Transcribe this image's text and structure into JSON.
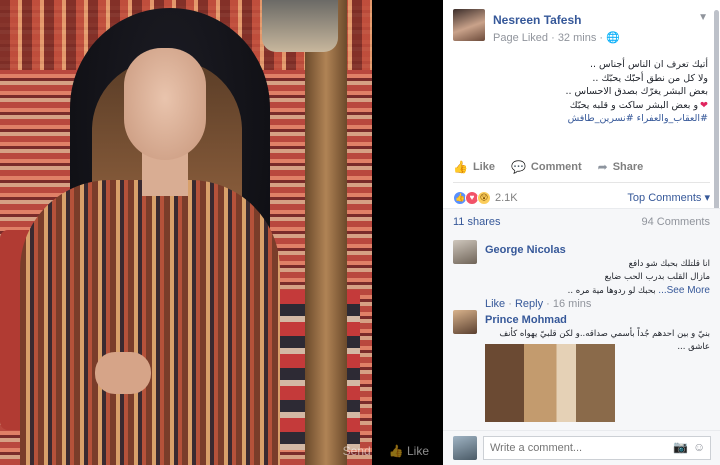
{
  "photo": {
    "footer_items": [
      "Send",
      "Like"
    ]
  },
  "post": {
    "page_name": "Nesreen Tafesh",
    "meta": "Page Liked · 32 mins ·",
    "text_lines": [
      "أتيك تعرف ان الناس أجناس ..",
      "ولا كل من نطق أحبّك يحبّك ..",
      "بعض البشر يغرّك بصدق الاحساس ..",
      "و بعض البشر ساكت و قلبه يحبّك"
    ],
    "hashtags": "#العقاب_والعفراء #نسرين_طافش",
    "actions": {
      "like": "Like",
      "comment": "Comment",
      "share": "Share"
    },
    "reaction_count": "2.1K",
    "top_comments": "Top Comments",
    "shares": "11 shares",
    "comment_count": "94 Comments"
  },
  "comments": [
    {
      "author": "George Nicolas",
      "lines": [
        "انا قلتلك بحبك شو دافع",
        "مازال القلب بدرب الحب ضايع",
        "بحبك لو ردوها مية مره .."
      ],
      "see_more": "See More...",
      "like": "Like",
      "reply": "Reply",
      "time": "16 mins"
    },
    {
      "author": "Prince Mohmad",
      "lines": [
        "بنيّ و بين احدهم جُداً بأسمي صداقه..و لكن قلبيّ يهواه كأنف عاشق ..."
      ]
    }
  ],
  "composer": {
    "placeholder": "Write a comment..."
  },
  "colors": {
    "link_blue": "#365899",
    "meta_gray": "#90949c",
    "panel_bg": "#f6f7f9"
  }
}
